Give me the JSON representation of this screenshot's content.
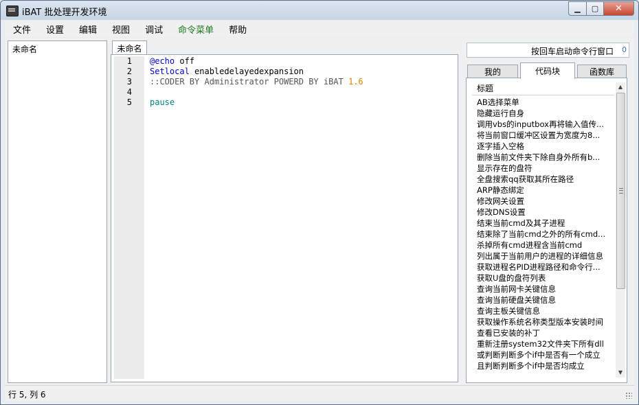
{
  "window": {
    "title": "iBAT 批处理开发环境"
  },
  "window_controls": {
    "minimize": "▁",
    "maximize": "▢",
    "close": "✕"
  },
  "menu": [
    "文件",
    "设置",
    "编辑",
    "视图",
    "调试",
    "命令菜单",
    "帮助"
  ],
  "left_panel": {
    "items": [
      "未命名"
    ]
  },
  "editor": {
    "tab_label": "未命名",
    "line_numbers": [
      "1",
      "2",
      "3",
      "4",
      "5"
    ],
    "lines": [
      {
        "parts": [
          {
            "text": "@echo",
            "cls": "kw-blue"
          },
          {
            "text": " off",
            "cls": ""
          }
        ]
      },
      {
        "parts": [
          {
            "text": "Setlocal",
            "cls": "kw-blue"
          },
          {
            "text": " enabledelayedexpansion",
            "cls": ""
          }
        ]
      },
      {
        "parts": [
          {
            "text": "::CODER BY Administrator POWERD BY iBAT ",
            "cls": "cmt"
          },
          {
            "text": "1.6",
            "cls": "num"
          }
        ]
      },
      {
        "parts": [
          {
            "text": "",
            "cls": ""
          }
        ]
      },
      {
        "parts": [
          {
            "text": "pause",
            "cls": "kw-teal"
          }
        ]
      }
    ]
  },
  "right_panel": {
    "hint": "按回车启动命令行窗口",
    "hint_count": "0",
    "tabs": [
      "我的",
      "代码块",
      "函数库"
    ],
    "active_tab": 1,
    "list_header": "标题",
    "items": [
      "AB选择菜单",
      "隐藏运行自身",
      "调用vbs的inputbox再将输入值传...",
      "将当前窗口缓冲区设置为宽度为8...",
      "逐字插入空格",
      "删除当前文件夹下除自身外所有b...",
      "显示存在的盘符",
      "全盘搜索qq获取其所在路径",
      "ARP静态绑定",
      "修改网关设置",
      "修改DNS设置",
      "结束当前cmd及其子进程",
      "结束除了当前cmd之外的所有cmd...",
      "杀掉所有cmd进程含当前cmd",
      "列出属于当前用户的进程的详细信息",
      "获取进程名PID进程路径和命令行...",
      "获取U盘的盘符列表",
      "查询当前网卡关键信息",
      "查询当前硬盘关键信息",
      "查询主板关键信息",
      "获取操作系统名称类型版本安装时间",
      "查看已安装的补丁",
      "重新注册system32文件夹下所有dll",
      "或判断判断多个if中是否有一个成立",
      "且判断判断多个if中是否均成立"
    ]
  },
  "status": {
    "text": "行 5, 列 6"
  }
}
